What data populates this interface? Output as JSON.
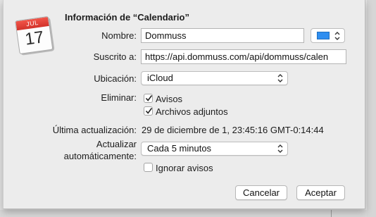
{
  "icon": {
    "month": "JUL",
    "day": "17"
  },
  "dialog": {
    "title": "Información de “Calendario”"
  },
  "name": {
    "label": "Nombre:",
    "value": "Dommuss",
    "color": "#2e8ef0"
  },
  "subscribed": {
    "label": "Suscrito a:",
    "value": "https://api.dommuss.com/api/dommuss/calen"
  },
  "location": {
    "label": "Ubicación:",
    "value": "iCloud"
  },
  "remove": {
    "label": "Eliminar:",
    "alerts": {
      "label": "Avisos",
      "checked": true
    },
    "attachments": {
      "label": "Archivos adjuntos",
      "checked": true
    }
  },
  "last_update": {
    "label": "Última actualización:",
    "value": "29 de diciembre de 1, 23:45:16 GMT-0:14:44"
  },
  "auto_refresh": {
    "label_line1": "Actualizar",
    "label_line2": "automáticamente:",
    "value": "Cada 5 minutos"
  },
  "ignore_alerts": {
    "label": "Ignorar avisos",
    "checked": false
  },
  "buttons": {
    "cancel": "Cancelar",
    "accept": "Aceptar"
  }
}
